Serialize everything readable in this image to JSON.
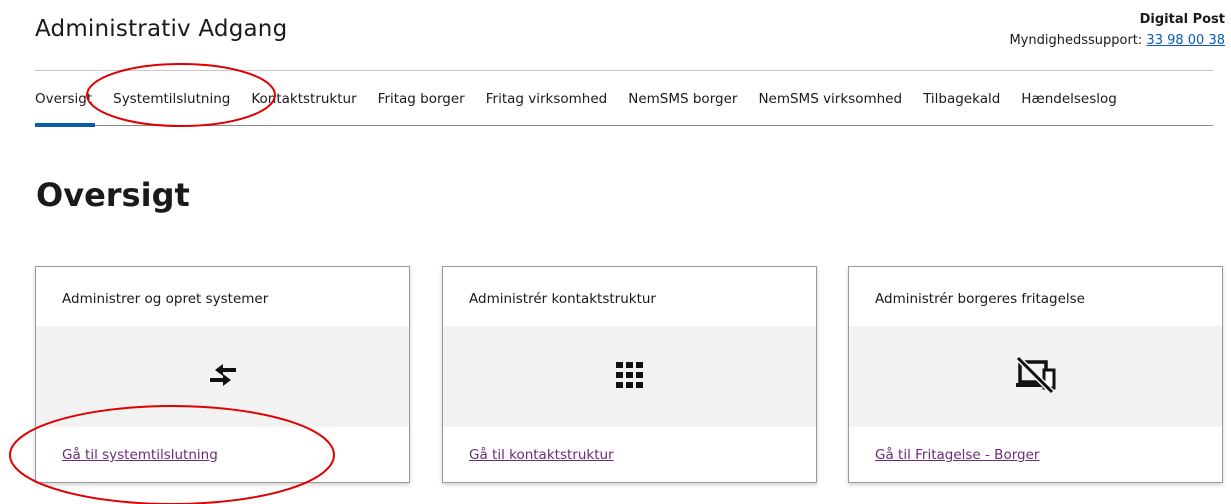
{
  "header": {
    "title": "Administrativ Adgang",
    "org_name": "Digital Post",
    "support_label": "Myndighedssupport:",
    "support_phone": "33 98 00 38"
  },
  "nav": {
    "items": [
      {
        "label": "Oversigt",
        "active": true
      },
      {
        "label": "Systemtilslutning"
      },
      {
        "label": "Kontaktstruktur"
      },
      {
        "label": "Fritag borger"
      },
      {
        "label": "Fritag virksomhed"
      },
      {
        "label": "NemSMS borger"
      },
      {
        "label": "NemSMS virksomhed"
      },
      {
        "label": "Tilbagekald"
      },
      {
        "label": "Hændelseslog"
      }
    ]
  },
  "main": {
    "heading": "Oversigt",
    "cards": [
      {
        "title": "Administrer og opret systemer",
        "icon": "swap-arrows-icon",
        "link": "Gå til systemtilslutning"
      },
      {
        "title": "Administrér kontaktstruktur",
        "icon": "grid-icon",
        "link": "Gå til kontaktstruktur"
      },
      {
        "title": "Administrér borgeres fritagelse",
        "icon": "devices-off-icon",
        "link": "Gå til Fritagelse - Borger"
      }
    ]
  },
  "colors": {
    "accent": "#0b5cad",
    "visited_link": "#6b2a7a",
    "annotation": "#e00000",
    "card_band": "#f2f2f2"
  }
}
